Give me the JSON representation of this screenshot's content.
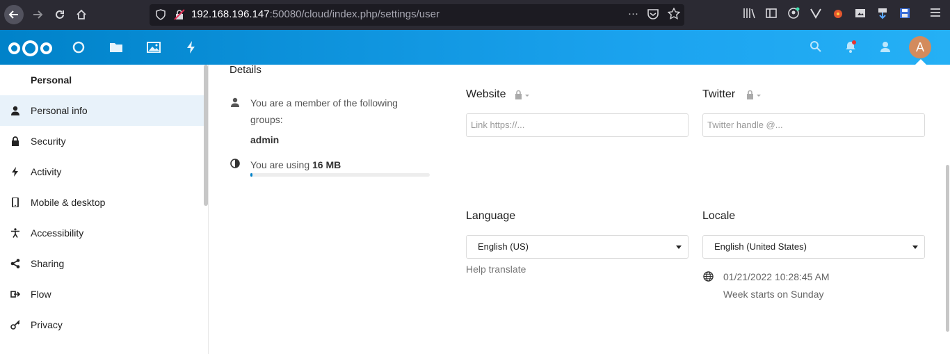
{
  "browser": {
    "url_host": "192.168.196.147",
    "url_rest": ":50080/cloud/index.php/settings/user",
    "actions": [
      "···",
      "pocket-icon",
      "star-icon"
    ]
  },
  "header": {
    "apps": [
      "dashboard-icon",
      "files-icon",
      "photos-icon",
      "activity-icon"
    ],
    "avatar_letter": "A",
    "colors": {
      "header_start": "#0082c9",
      "header_end": "#25b0f5",
      "avatar": "#d38b5d"
    }
  },
  "sidebar": {
    "section_title": "Personal",
    "items": [
      {
        "label": "Personal info",
        "icon": "user-icon"
      },
      {
        "label": "Security",
        "icon": "lock-icon"
      },
      {
        "label": "Activity",
        "icon": "bolt-icon"
      },
      {
        "label": "Mobile & desktop",
        "icon": "phone-icon"
      },
      {
        "label": "Accessibility",
        "icon": "accessibility-icon"
      },
      {
        "label": "Sharing",
        "icon": "share-icon"
      },
      {
        "label": "Flow",
        "icon": "flow-icon"
      },
      {
        "label": "Privacy",
        "icon": "key-icon"
      }
    ]
  },
  "details": {
    "title": "Details",
    "groups_text": "You are a member of the following groups:",
    "group_name": "admin",
    "usage_prefix": "You are using",
    "usage_value": "16 MB"
  },
  "website": {
    "label": "Website",
    "placeholder": "Link https://..."
  },
  "twitter": {
    "label": "Twitter",
    "placeholder": "Twitter handle @..."
  },
  "language": {
    "label": "Language",
    "selected": "English (US)",
    "help_link": "Help translate"
  },
  "locale": {
    "label": "Locale",
    "selected": "English (United States)",
    "datetime": "01/21/2022 10:28:45 AM",
    "week_start": "Week starts on Sunday"
  }
}
